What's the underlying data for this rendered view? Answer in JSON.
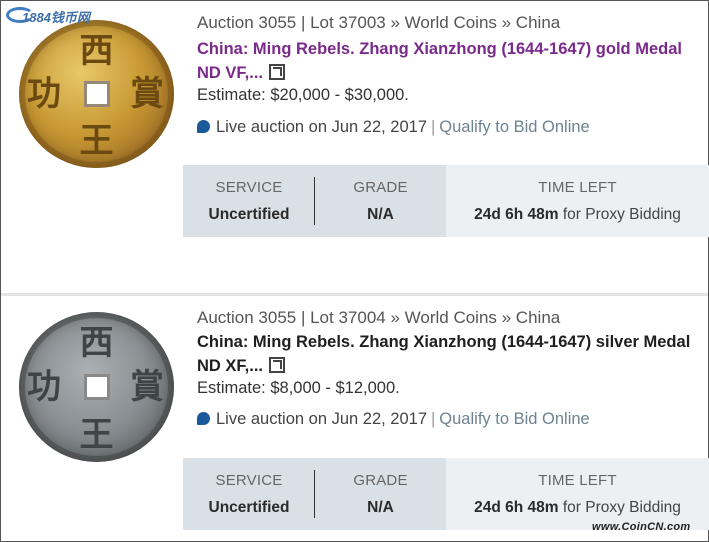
{
  "watermark_top": "1884钱币网",
  "watermark_bottom": "www.CoinCN.com",
  "listings": [
    {
      "coin_chars": {
        "top": "西",
        "bottom": "王",
        "left": "功",
        "right": "賞"
      },
      "breadcrumb": "Auction 3055 | Lot 37003 » World Coins » China",
      "title_line1": "China: Ming Rebels. Zhang Xianzhong (1644-1647) gold Medal",
      "title_line2": "ND VF,...",
      "estimate": "Estimate: $20,000 - $30,000.",
      "live": "Live auction on Jun 22, 2017",
      "qualify": "Qualify to Bid Online",
      "service_head": "SERVICE",
      "service_val": "Uncertified",
      "grade_head": "GRADE",
      "grade_val": "N/A",
      "time_head": "TIME LEFT",
      "time_val": "24d 6h 48m",
      "time_sub": "for Proxy Bidding"
    },
    {
      "coin_chars": {
        "top": "西",
        "bottom": "王",
        "left": "功",
        "right": "賞"
      },
      "breadcrumb": "Auction 3055 | Lot 37004 » World Coins » China",
      "title_line1": "China: Ming Rebels. Zhang Xianzhong (1644-1647) silver Medal",
      "title_line2": "ND XF,...",
      "estimate": "Estimate: $8,000 - $12,000.",
      "live": "Live auction on Jun 22, 2017",
      "qualify": "Qualify to Bid Online",
      "service_head": "SERVICE",
      "service_val": "Uncertified",
      "grade_head": "GRADE",
      "grade_val": "N/A",
      "time_head": "TIME LEFT",
      "time_val": "24d 6h 48m",
      "time_sub": "for Proxy Bidding"
    }
  ],
  "colors": {
    "title_gold": "#7a2a8a",
    "title_silver": "#1f1f1f",
    "infobar_bg": "#d9e0e6",
    "infobar_time_bg": "#edf0f3",
    "qualify_link": "#6e8391",
    "live_icon": "#1a5a9a"
  },
  "icons": [
    "gavel-icon",
    "external-link-icon"
  ]
}
